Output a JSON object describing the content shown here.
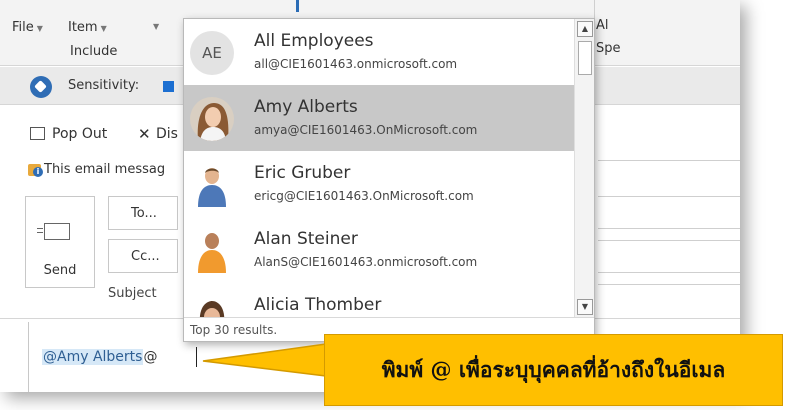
{
  "ribbon": {
    "file_menu": "File",
    "item_menu": "Item",
    "group_label": "Include",
    "right_clip_top": "Al",
    "right_clip_bottom": "Spe"
  },
  "sensitivity": {
    "label": "Sensitivity:"
  },
  "actions": {
    "pop_out": "Pop Out",
    "discard": "Dis"
  },
  "info_message": "This email messag",
  "compose": {
    "send_label": "Send",
    "to_label": "To...",
    "cc_label": "Cc...",
    "subject_label": "Subject",
    "mention_name": "@Amy Alberts",
    "mention_at": "@"
  },
  "suggestions": {
    "items": [
      {
        "name": "All Employees",
        "email": "all@CIE1601463.onmicrosoft.com",
        "avatar": "AE"
      },
      {
        "name": "Amy Alberts",
        "email": "amya@CIE1601463.OnMicrosoft.com",
        "avatar": "photo",
        "selected": true
      },
      {
        "name": "Eric Gruber",
        "email": "ericg@CIE1601463.OnMicrosoft.com",
        "avatar": "photo"
      },
      {
        "name": "Alan Steiner",
        "email": "AlanS@CIE1601463.onmicrosoft.com",
        "avatar": "photo"
      },
      {
        "name": "Alicia Thomber",
        "email": "",
        "avatar": "photo"
      }
    ],
    "footer": "Top 30 results."
  },
  "callout": {
    "text": "พิมพ์ @ เพื่อระบุบุคคลที่อ้างถึงในอีเมล"
  },
  "colors": {
    "accent": "#2f6db5",
    "selection": "#c8c8c8",
    "callout": "#ffbf00",
    "mention_bg": "#d6e8f7"
  }
}
